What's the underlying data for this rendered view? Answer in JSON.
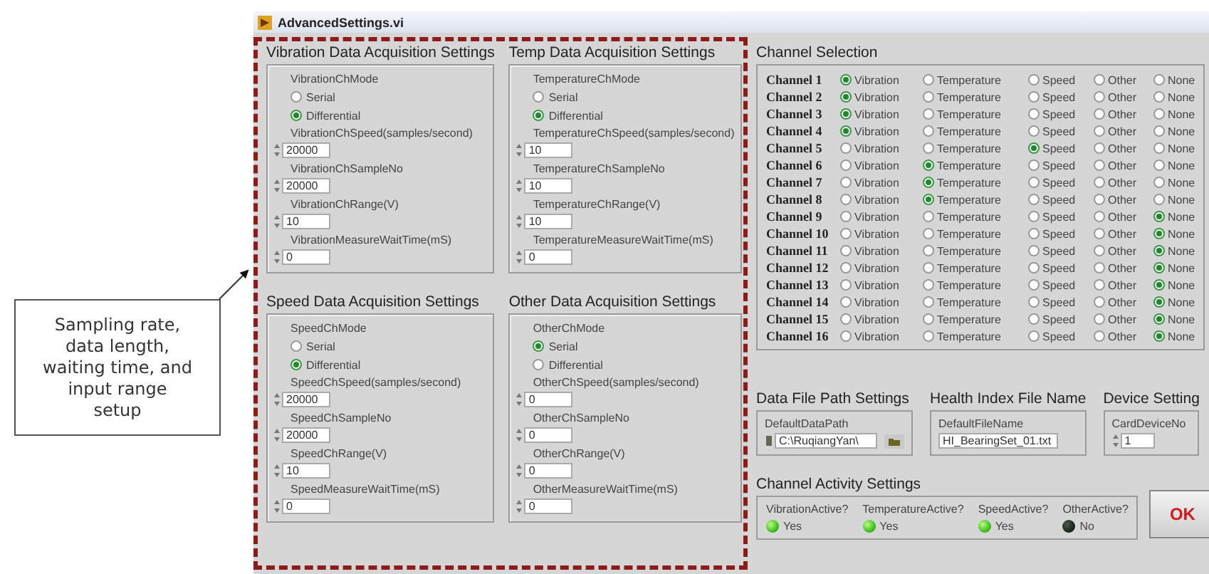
{
  "callout": {
    "text": "Sampling rate,\ndata length,\nwaiting time, and\ninput range\nsetup"
  },
  "window": {
    "title": "AdvancedSettings.vi"
  },
  "acquisition_groups": [
    {
      "title": "Vibration Data Acquisition Settings",
      "mode_label": "VibrationChMode",
      "modes": [
        {
          "label": "Serial",
          "selected": false
        },
        {
          "label": "Differential",
          "selected": true
        }
      ],
      "fields": [
        {
          "label": "VibrationChSpeed(samples/second)",
          "value": "20000"
        },
        {
          "label": "VibrationChSampleNo",
          "value": "20000"
        },
        {
          "label": "VibrationChRange(V)",
          "value": "10"
        },
        {
          "label": "VibrationMeasureWaitTime(mS)",
          "value": "0"
        }
      ]
    },
    {
      "title": "Temp Data Acquisition Settings",
      "mode_label": "TemperatureChMode",
      "modes": [
        {
          "label": "Serial",
          "selected": false
        },
        {
          "label": "Differential",
          "selected": true
        }
      ],
      "fields": [
        {
          "label": "TemperatureChSpeed(samples/second)",
          "value": "10"
        },
        {
          "label": "TemperatureChSampleNo",
          "value": "10"
        },
        {
          "label": "TemperatureChRange(V)",
          "value": "10"
        },
        {
          "label": "TemperatureMeasureWaitTime(mS)",
          "value": "0"
        }
      ]
    },
    {
      "title": "Speed Data Acquisition Settings",
      "mode_label": "SpeedChMode",
      "modes": [
        {
          "label": "Serial",
          "selected": false
        },
        {
          "label": "Differential",
          "selected": true
        }
      ],
      "fields": [
        {
          "label": "SpeedChSpeed(samples/second)",
          "value": "20000"
        },
        {
          "label": "SpeedChSampleNo",
          "value": "20000"
        },
        {
          "label": "SpeedChRange(V)",
          "value": "10"
        },
        {
          "label": "SpeedMeasureWaitTime(mS)",
          "value": "0"
        }
      ]
    },
    {
      "title": "Other Data Acquisition Settings",
      "mode_label": "OtherChMode",
      "modes": [
        {
          "label": "Serial",
          "selected": true
        },
        {
          "label": "Differential",
          "selected": false
        }
      ],
      "fields": [
        {
          "label": "OtherChSpeed(samples/second)",
          "value": "0"
        },
        {
          "label": "OtherChSampleNo",
          "value": "0"
        },
        {
          "label": "OtherChRange(V)",
          "value": "0"
        },
        {
          "label": "OtherMeasureWaitTime(mS)",
          "value": "0"
        }
      ]
    }
  ],
  "channel_selection": {
    "title": "Channel Selection",
    "rows": [
      {
        "label": "Channel 1",
        "options": [
          {
            "label": "Vibration",
            "selected": true
          },
          {
            "label": "Temperature",
            "selected": false
          },
          {
            "label": "Speed",
            "selected": false
          },
          {
            "label": "Other",
            "selected": false
          },
          {
            "label": "None",
            "selected": false
          }
        ]
      },
      {
        "label": "Channel 2",
        "options": [
          {
            "label": "Vibration",
            "selected": true
          },
          {
            "label": "Temperature",
            "selected": false
          },
          {
            "label": "Speed",
            "selected": false
          },
          {
            "label": "Other",
            "selected": false
          },
          {
            "label": "None",
            "selected": false
          }
        ]
      },
      {
        "label": "Channel 3",
        "options": [
          {
            "label": "Vibration",
            "selected": true
          },
          {
            "label": "Temperature",
            "selected": false
          },
          {
            "label": "Speed",
            "selected": false
          },
          {
            "label": "Other",
            "selected": false
          },
          {
            "label": "None",
            "selected": false
          }
        ]
      },
      {
        "label": "Channel 4",
        "options": [
          {
            "label": "Vibration",
            "selected": true
          },
          {
            "label": "Temperature",
            "selected": false
          },
          {
            "label": "Speed",
            "selected": false
          },
          {
            "label": "Other",
            "selected": false
          },
          {
            "label": "None",
            "selected": false
          }
        ]
      },
      {
        "label": "Channel 5",
        "options": [
          {
            "label": "Vibration",
            "selected": false
          },
          {
            "label": "Temperature",
            "selected": false
          },
          {
            "label": "Speed",
            "selected": true
          },
          {
            "label": "Other",
            "selected": false
          },
          {
            "label": "None",
            "selected": false
          }
        ]
      },
      {
        "label": "Channel 6",
        "options": [
          {
            "label": "Vibration",
            "selected": false
          },
          {
            "label": "Temperature",
            "selected": true
          },
          {
            "label": "Speed",
            "selected": false
          },
          {
            "label": "Other",
            "selected": false
          },
          {
            "label": "None",
            "selected": false
          }
        ]
      },
      {
        "label": "Channel 7",
        "options": [
          {
            "label": "Vibration",
            "selected": false
          },
          {
            "label": "Temperature",
            "selected": true
          },
          {
            "label": "Speed",
            "selected": false
          },
          {
            "label": "Other",
            "selected": false
          },
          {
            "label": "None",
            "selected": false
          }
        ]
      },
      {
        "label": "Channel 8",
        "options": [
          {
            "label": "Vibration",
            "selected": false
          },
          {
            "label": "Temperature",
            "selected": true
          },
          {
            "label": "Speed",
            "selected": false
          },
          {
            "label": "Other",
            "selected": false
          },
          {
            "label": "None",
            "selected": false
          }
        ]
      },
      {
        "label": "Channel 9",
        "options": [
          {
            "label": "Vibration",
            "selected": false
          },
          {
            "label": "Temperature",
            "selected": false
          },
          {
            "label": "Speed",
            "selected": false
          },
          {
            "label": "Other",
            "selected": false
          },
          {
            "label": "None",
            "selected": true
          }
        ]
      },
      {
        "label": "Channel 10",
        "options": [
          {
            "label": "Vibration",
            "selected": false
          },
          {
            "label": "Temperature",
            "selected": false
          },
          {
            "label": "Speed",
            "selected": false
          },
          {
            "label": "Other",
            "selected": false
          },
          {
            "label": "None",
            "selected": true
          }
        ]
      },
      {
        "label": "Channel 11",
        "options": [
          {
            "label": "Vibration",
            "selected": false
          },
          {
            "label": "Temperature",
            "selected": false
          },
          {
            "label": "Speed",
            "selected": false
          },
          {
            "label": "Other",
            "selected": false
          },
          {
            "label": "None",
            "selected": true
          }
        ]
      },
      {
        "label": "Channel 12",
        "options": [
          {
            "label": "Vibration",
            "selected": false
          },
          {
            "label": "Temperature",
            "selected": false
          },
          {
            "label": "Speed",
            "selected": false
          },
          {
            "label": "Other",
            "selected": false
          },
          {
            "label": "None",
            "selected": true
          }
        ]
      },
      {
        "label": "Channel 13",
        "options": [
          {
            "label": "Vibration",
            "selected": false
          },
          {
            "label": "Temperature",
            "selected": false
          },
          {
            "label": "Speed",
            "selected": false
          },
          {
            "label": "Other",
            "selected": false
          },
          {
            "label": "None",
            "selected": true
          }
        ]
      },
      {
        "label": "Channel 14",
        "options": [
          {
            "label": "Vibration",
            "selected": false
          },
          {
            "label": "Temperature",
            "selected": false
          },
          {
            "label": "Speed",
            "selected": false
          },
          {
            "label": "Other",
            "selected": false
          },
          {
            "label": "None",
            "selected": true
          }
        ]
      },
      {
        "label": "Channel 15",
        "options": [
          {
            "label": "Vibration",
            "selected": false
          },
          {
            "label": "Temperature",
            "selected": false
          },
          {
            "label": "Speed",
            "selected": false
          },
          {
            "label": "Other",
            "selected": false
          },
          {
            "label": "None",
            "selected": true
          }
        ]
      },
      {
        "label": "Channel 16",
        "options": [
          {
            "label": "Vibration",
            "selected": false
          },
          {
            "label": "Temperature",
            "selected": false
          },
          {
            "label": "Speed",
            "selected": false
          },
          {
            "label": "Other",
            "selected": false
          },
          {
            "label": "None",
            "selected": true
          }
        ]
      }
    ]
  },
  "file_settings": [
    {
      "kind": "path",
      "title": "Data File Path Settings",
      "label": "DefaultDataPath",
      "value": "C:\\RuqiangYan\\"
    },
    {
      "kind": "text",
      "title": "Health Index File Name",
      "label": "DefaultFileName",
      "value": "HI_BearingSet_01.txt"
    },
    {
      "kind": "numeric",
      "title": "Device Setting",
      "label": "CardDeviceNo",
      "value": "1"
    }
  ],
  "channel_activity": {
    "title": "Channel Activity Settings",
    "items": [
      {
        "label": "VibrationActive?",
        "on": true,
        "text": "Yes"
      },
      {
        "label": "TemperatureActive?",
        "on": true,
        "text": "Yes"
      },
      {
        "label": "SpeedActive?",
        "on": true,
        "text": "Yes"
      },
      {
        "label": "OtherActive?",
        "on": false,
        "text": "No"
      }
    ]
  },
  "ok_button": "OK"
}
